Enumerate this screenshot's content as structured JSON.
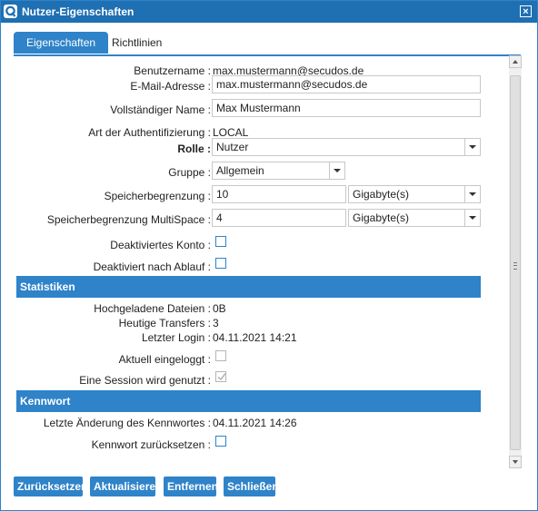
{
  "window": {
    "title": "Nutzer-Eigenschaften",
    "close_symbol": "×"
  },
  "tabs": [
    {
      "label": "Eigenschaften",
      "active": true
    },
    {
      "label": "Richtlinien",
      "active": false
    }
  ],
  "fields": {
    "username": {
      "label": "Benutzername :",
      "value": "max.mustermann@secudos.de"
    },
    "email": {
      "label": "E-Mail-Adresse :",
      "value": "max.mustermann@secudos.de"
    },
    "fullname": {
      "label": "Vollständiger Name :",
      "value": "Max Mustermann"
    },
    "auth": {
      "label": "Art der Authentifizierung :",
      "value": "LOCAL"
    },
    "role": {
      "label": "Rolle :",
      "value": "Nutzer"
    },
    "group": {
      "label": "Gruppe :",
      "value": "Allgemein"
    },
    "storage": {
      "label": "Speicherbegrenzung :",
      "value": "10",
      "unit": "Gigabyte(s)"
    },
    "storage_multispace": {
      "label": "Speicherbegrenzung MultiSpace :",
      "value": "4",
      "unit": "Gigabyte(s)"
    },
    "deactivated": {
      "label": "Deaktiviertes Konto :",
      "checked": false
    },
    "deactivated_expiry": {
      "label": "Deaktiviert nach Ablauf :",
      "checked": false
    }
  },
  "statistics": {
    "header": "Statistiken",
    "uploaded": {
      "label": "Hochgeladene Dateien :",
      "value": "0B"
    },
    "transfers": {
      "label": "Heutige Transfers :",
      "value": "3"
    },
    "last_login": {
      "label": "Letzter Login :",
      "value": "04.11.2021 14:21"
    },
    "logged_in": {
      "label": "Aktuell eingeloggt :",
      "checked": false
    },
    "session": {
      "label": "Eine Session wird genutzt :",
      "checked": true
    }
  },
  "password": {
    "header": "Kennwort",
    "last_change": {
      "label": "Letzte Änderung des Kennwortes :",
      "value": "04.11.2021 14:26"
    },
    "reset": {
      "label": "Kennwort zurücksetzen :",
      "checked": false
    }
  },
  "buttons": {
    "reset": "Zurücksetzen",
    "update": "Aktualisieren",
    "remove": "Entfernen",
    "close": "Schließen"
  },
  "colors": {
    "title_bar": "#1f6fb3",
    "accent": "#2f83c9"
  }
}
